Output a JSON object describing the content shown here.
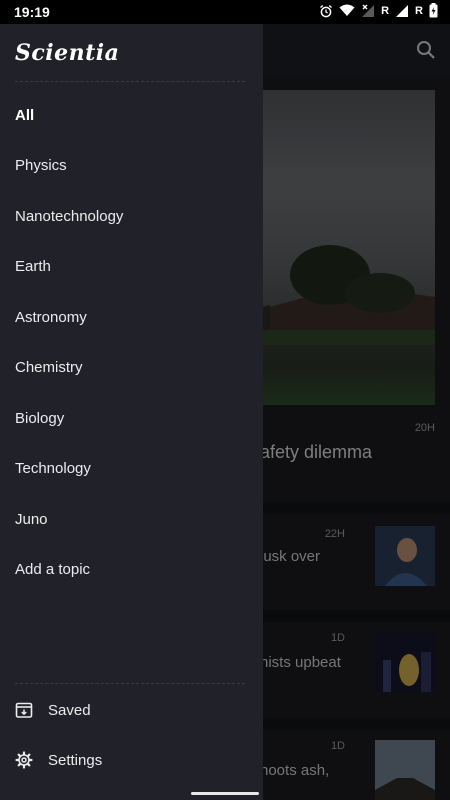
{
  "status_bar": {
    "time": "19:19",
    "roaming_1": "R",
    "roaming_2": "R"
  },
  "drawer": {
    "logo": "Scientia",
    "topics": [
      {
        "label": "All",
        "active": true
      },
      {
        "label": "Physics",
        "active": false
      },
      {
        "label": "Nanotechnology",
        "active": false
      },
      {
        "label": "Earth",
        "active": false
      },
      {
        "label": "Astronomy",
        "active": false
      },
      {
        "label": "Chemistry",
        "active": false
      },
      {
        "label": "Biology",
        "active": false
      },
      {
        "label": "Technology",
        "active": false
      },
      {
        "label": "Juno",
        "active": false
      },
      {
        "label": "Add a topic",
        "active": false
      }
    ],
    "bottom_items": [
      {
        "label": "Saved",
        "icon": "saved-icon"
      },
      {
        "label": "Settings",
        "icon": "gear-icon"
      }
    ]
  },
  "feed": {
    "hero": {
      "time": "20H",
      "title_fragment": "afety dilemma"
    },
    "cards": [
      {
        "time": "22H",
        "title_fragment": "lusk over"
      },
      {
        "time": "1D",
        "title_fragment": "nists upbeat"
      },
      {
        "time": "1D",
        "title_fragment": "hoots ash,"
      }
    ]
  },
  "colors": {
    "drawer_bg": "#202129",
    "feed_bg": "#1a1b20",
    "text_primary": "#ececee",
    "text_secondary": "#9a9ba0"
  }
}
